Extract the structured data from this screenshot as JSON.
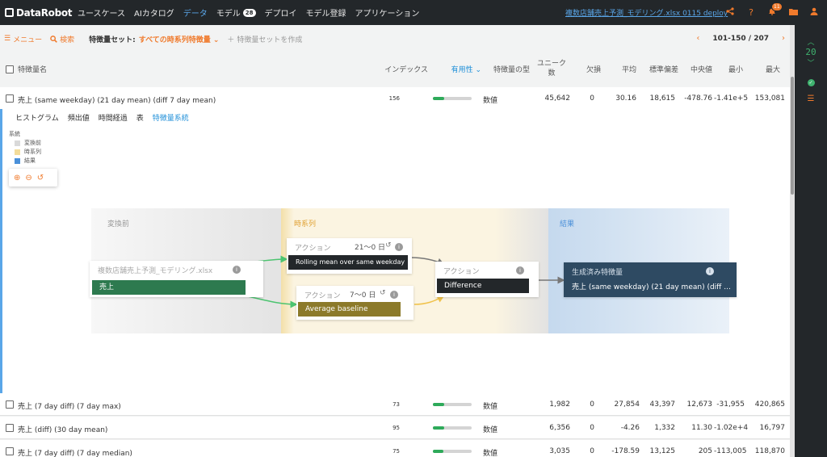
{
  "nav": {
    "logo": "DataRobot",
    "items": [
      "ユースケース",
      "AIカタログ",
      "データ",
      "モデル",
      "デプロイ",
      "モデル登録",
      "アプリケーション"
    ],
    "model_count": "28",
    "dataset": "複数店舗売上予測_モデリング.xlsx 0115 deploy",
    "notifications": "11"
  },
  "toolbar": {
    "menu": "メニュー",
    "search": "検索",
    "featureset_label": "特徴量セット:",
    "featureset_value": "すべての時系列特徴量",
    "create": "特徴量セットを作成",
    "pager": "101-150 / 207"
  },
  "columns": {
    "name": "特徴量名",
    "index": "インデックス",
    "importance": "有用性",
    "type": "特徴量の型",
    "unique_1": "ユニーク",
    "unique_2": "数",
    "missing": "欠損",
    "mean": "平均",
    "std": "標準偏差",
    "median": "中央値",
    "min": "最小",
    "max": "最大"
  },
  "rows": [
    {
      "name": "売上 (same weekday) (21 day mean) (diff 7 day mean)",
      "index": "156",
      "importance": 0.3,
      "type": "数値",
      "unique": "45,642",
      "missing": "0",
      "mean": "30.16",
      "std": "18,615",
      "median": "-478.76",
      "min": "-1.41e+5",
      "max": "153,081"
    },
    {
      "name": "売上 (7 day diff) (7 day max)",
      "index": "73",
      "importance": 0.3,
      "type": "数値",
      "unique": "1,982",
      "missing": "0",
      "mean": "27,854",
      "std": "43,397",
      "median": "12,673",
      "min": "-31,955",
      "max": "420,865"
    },
    {
      "name": "売上 (diff) (30 day mean)",
      "index": "95",
      "importance": 0.3,
      "type": "数値",
      "unique": "6,356",
      "missing": "0",
      "mean": "-4.26",
      "std": "1,332",
      "median": "11.30",
      "min": "-1.02e+4",
      "max": "16,797"
    },
    {
      "name": "売上 (7 day diff) (7 day median)",
      "index": "75",
      "importance": 0.28,
      "type": "数値",
      "unique": "3,035",
      "missing": "0",
      "mean": "-178.59",
      "std": "13,125",
      "median": "205",
      "min": "-113,005",
      "max": "118,870"
    }
  ],
  "subtabs": [
    "ヒストグラム",
    "頻出値",
    "時間経過",
    "表",
    "特徴量系統"
  ],
  "legend": {
    "title": "系統",
    "items": [
      {
        "label": "変換前",
        "color": "#d9d9d9"
      },
      {
        "label": "時系列",
        "color": "#f3dc9a"
      },
      {
        "label": "結果",
        "color": "#4a90d9"
      }
    ]
  },
  "lineage": {
    "lanes": {
      "before": "変換前",
      "ts": "時系列",
      "result": "結果"
    },
    "source": {
      "title": "複数店舗売上予測_モデリング.xlsx",
      "feature": "売上"
    },
    "action1": {
      "title": "アクション",
      "range": "21〜0 日",
      "op": "Rolling mean over same weekday"
    },
    "action2": {
      "title": "アクション",
      "range": "7〜0 日",
      "op": "Average baseline"
    },
    "action3": {
      "title": "アクション",
      "op": "Difference"
    },
    "output": {
      "title": "生成済み特徴量",
      "feature": "売上 (same weekday) (21 day mean) (diff ..."
    }
  },
  "rail": {
    "count": "20"
  },
  "colors": {
    "accent": "#f07a2c",
    "link": "#5aa6e8",
    "success": "#2eaa5a",
    "topbar": "#23272a"
  }
}
